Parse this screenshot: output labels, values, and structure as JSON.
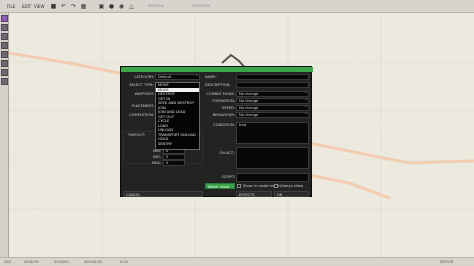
{
  "menubar": {
    "items": [
      "FILE",
      "EDIT",
      "VIEW",
      "TOOLS",
      "SETTINGS",
      "PLAY",
      "HELP"
    ],
    "tabs": [
      "PREVIEW",
      "CONTINUE"
    ]
  },
  "dialog": {
    "left": {
      "category_label": "CATEGORY:",
      "category_value": "Default",
      "select_type_label": "SELECT TYPE:",
      "waypoint_label": "WAYPOINT:",
      "placement_label": "PLACEMENT:",
      "completion_label": "COMPLETION:",
      "timeout_label": "TIMEOUT:",
      "min_label": "MIN:",
      "min_value": "0",
      "mid_label": "MID:",
      "mid_value": "0",
      "max_label": "MAX:",
      "max_value": "0"
    },
    "type_options": [
      "MOVE",
      "MOVE",
      "DESTROY",
      "GET IN",
      "SEEK AND DESTROY",
      "JOIN",
      "JOIN AND LEAD",
      "GET OUT",
      "CYCLE",
      "LOAD",
      "UNLOAD",
      "TRANSPORT UNLOAD",
      "HOLD",
      "SENTRY"
    ],
    "right": {
      "name_label": "NAME:",
      "description_label": "DESCRIPTION:",
      "combat_mode_label": "COMBAT MODE:",
      "combat_mode_value": "No change",
      "formation_label": "FORMATION:",
      "formation_value": "No change",
      "speed_label": "SPEED:",
      "speed_value": "No change",
      "behaviour_label": "BEHAVIOUR:",
      "behaviour_value": "No change",
      "condition_label": "CONDITION:",
      "condition_value": "true",
      "on_act_label": "ON ACT.:",
      "script_label": "SCRIPT:",
      "show_in_cadet_label": "Show in cadet mode",
      "always_show_label": "Always show",
      "never_show_label": "Never show"
    },
    "cancel_label": "CANCEL",
    "effects_label": "EFFECTS",
    "ok_label": "OK"
  },
  "statusbar": {
    "items": [
      "026",
      "4058.09",
      "003/000",
      "000:00:00",
      "0.00",
      "EDITOR"
    ]
  },
  "colors": {
    "accent": "#3aa648",
    "map_bg": "#eceadf",
    "road": "#f2cdb1"
  }
}
